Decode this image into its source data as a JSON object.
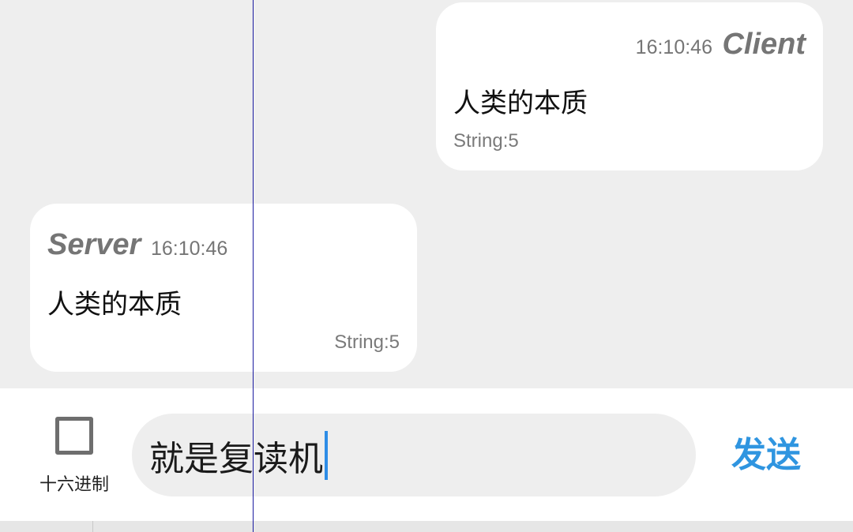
{
  "messages": [
    {
      "sender": "Client",
      "time": "16:10:46",
      "text": "人类的本质",
      "meta": "String:5"
    },
    {
      "sender": "Server",
      "time": "16:10:46",
      "text": "人类的本质",
      "meta": "String:5"
    }
  ],
  "input_bar": {
    "hex_label": "十六进制",
    "hex_checked": false,
    "input_value": "就是复读机",
    "send_label": "发送"
  },
  "colors": {
    "background": "#eeeeee",
    "bubble": "#ffffff",
    "sender_text": "#757575",
    "send_button": "#2f95e0",
    "caret": "#2e8de6",
    "guide_line": "#1a1aa0"
  }
}
